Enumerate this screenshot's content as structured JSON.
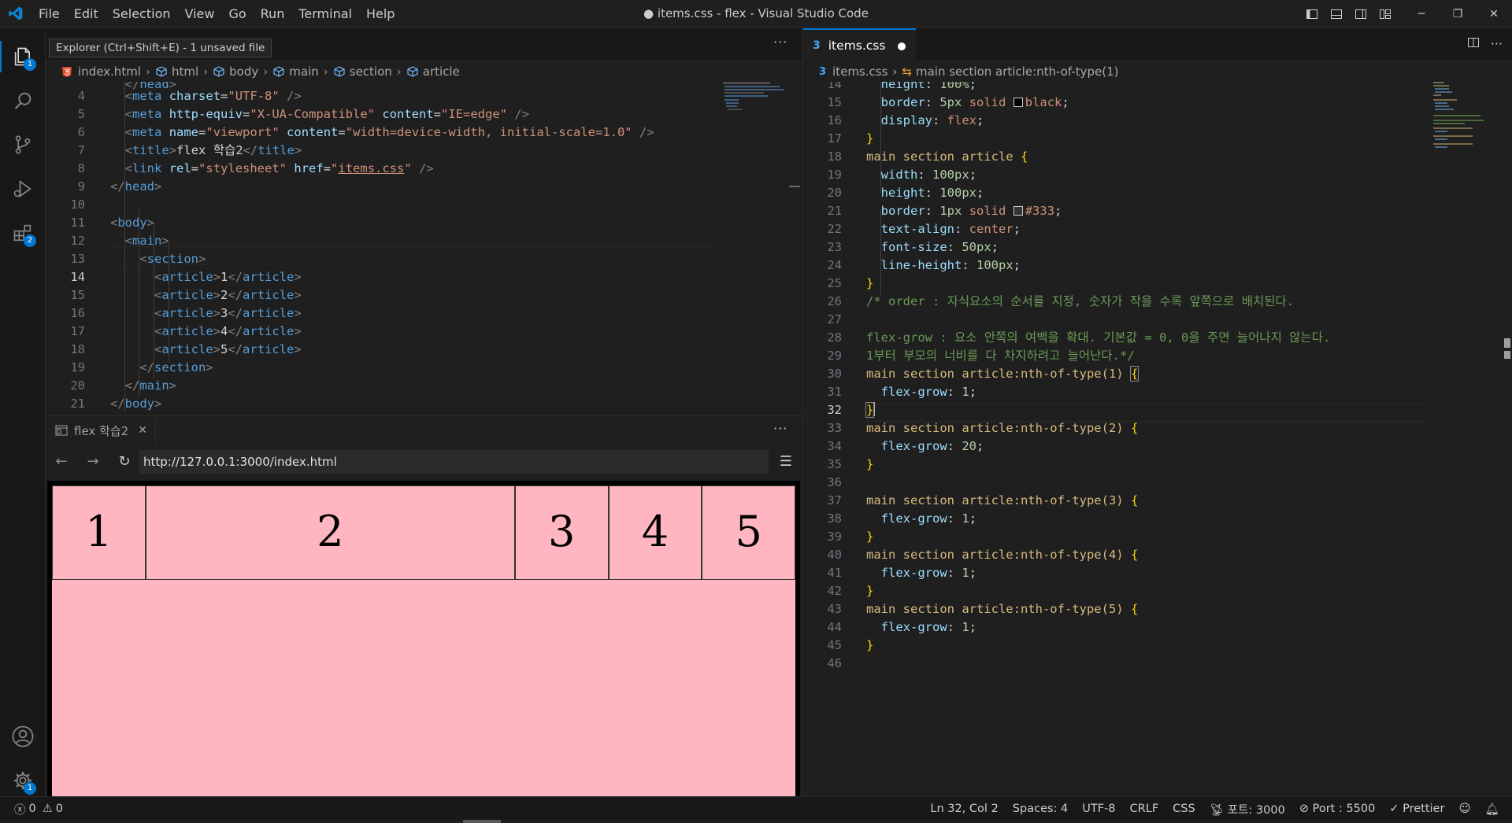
{
  "titlebar": {
    "menus": [
      "File",
      "Edit",
      "Selection",
      "View",
      "Go",
      "Run",
      "Terminal",
      "Help"
    ],
    "title": "● items.css - flex - Visual Studio Code"
  },
  "activity": {
    "explorer_badge": "1",
    "extensions_badge": "2",
    "settings_badge": "1"
  },
  "left_editor": {
    "tooltip": "Explorer (Ctrl+Shift+E) - 1 unsaved file",
    "breadcrumb": [
      "index.html",
      "html",
      "body",
      "main",
      "section",
      "article"
    ],
    "line_numbers": [
      "4",
      "5",
      "6",
      "7",
      "8",
      "9",
      "10",
      "11",
      "12",
      "13",
      "14",
      "15",
      "16",
      "17",
      "18",
      "19",
      "20",
      "21"
    ],
    "current_line": "14"
  },
  "browser": {
    "tab_label": "flex 학습2",
    "url": "http://127.0.0.1:3000/index.html",
    "articles": [
      "1",
      "2",
      "3",
      "4",
      "5"
    ],
    "flex_grow": [
      1,
      4,
      1,
      1,
      1
    ],
    "colors": {
      "background": "#ffb6c1",
      "section_border": "#000000",
      "article_border": "#333333"
    }
  },
  "right_editor": {
    "tab_label": "items.css",
    "breadcrumb_file": "items.css",
    "breadcrumb_selector": "main section article:nth-of-type(1)",
    "line_numbers": [
      "14",
      "15",
      "16",
      "17",
      "18",
      "19",
      "20",
      "21",
      "22",
      "23",
      "24",
      "25",
      "26",
      "27",
      "28",
      "29",
      "30",
      "31",
      "32",
      "33",
      "34",
      "35",
      "36",
      "37",
      "38",
      "39",
      "40",
      "41",
      "42",
      "43",
      "44",
      "45",
      "46"
    ],
    "current_line": "32"
  },
  "statusbar": {
    "errors": "0",
    "warnings": "0",
    "position": "Ln 32, Col 2",
    "spaces": "Spaces: 4",
    "encoding": "UTF-8",
    "eol": "CRLF",
    "language": "CSS",
    "port_kr": "포트: 3000",
    "port": "Port : 5500",
    "prettier": "Prettier"
  }
}
